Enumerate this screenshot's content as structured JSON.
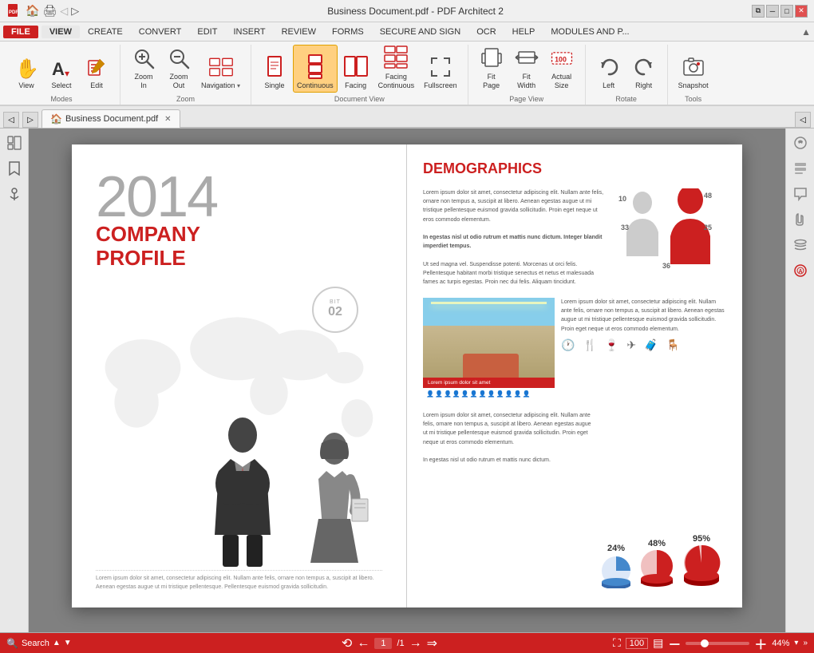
{
  "titleBar": {
    "title": "Business Document.pdf  -  PDF Architect 2",
    "appIcon": "pdf-icon"
  },
  "menuBar": {
    "fileLabel": "FILE",
    "items": [
      "VIEW",
      "CREATE",
      "CONVERT",
      "EDIT",
      "INSERT",
      "REVIEW",
      "FORMS",
      "SECURE AND SIGN",
      "OCR",
      "HELP",
      "MODULES AND P..."
    ]
  },
  "ribbon": {
    "groups": [
      {
        "name": "Modes",
        "buttons": [
          {
            "id": "view",
            "label": "View",
            "icon": "hand"
          },
          {
            "id": "select",
            "label": "Select",
            "icon": "cursor"
          },
          {
            "id": "edit",
            "label": "Edit",
            "icon": "edit"
          }
        ]
      },
      {
        "name": "Zoom",
        "buttons": [
          {
            "id": "zoom-in",
            "label": "Zoom\nIn",
            "icon": "zoom-in"
          },
          {
            "id": "zoom-out",
            "label": "Zoom\nOut",
            "icon": "zoom-out"
          },
          {
            "id": "navigation",
            "label": "Navigation",
            "icon": "nav",
            "hasDropdown": true
          }
        ]
      },
      {
        "name": "Document View",
        "buttons": [
          {
            "id": "single",
            "label": "Single",
            "icon": "single"
          },
          {
            "id": "continuous",
            "label": "Continuous",
            "icon": "continuous",
            "active": true
          },
          {
            "id": "facing",
            "label": "Facing",
            "icon": "facing"
          },
          {
            "id": "facing-continuous",
            "label": "Facing\nContinuous",
            "icon": "facing-cont"
          },
          {
            "id": "fullscreen",
            "label": "Fullscreen",
            "icon": "fullscreen"
          }
        ]
      },
      {
        "name": "Page View",
        "buttons": [
          {
            "id": "fit-page",
            "label": "Fit\nPage",
            "icon": "fit-page"
          },
          {
            "id": "fit-width",
            "label": "Fit\nWidth",
            "icon": "fit-width"
          },
          {
            "id": "actual-size",
            "label": "Actual\nSize",
            "icon": "actual"
          }
        ]
      },
      {
        "name": "Rotate",
        "buttons": [
          {
            "id": "left",
            "label": "Left",
            "icon": "left"
          },
          {
            "id": "right",
            "label": "Right",
            "icon": "right"
          }
        ]
      },
      {
        "name": "Tools",
        "buttons": [
          {
            "id": "snapshot",
            "label": "Snapshot",
            "icon": "snapshot"
          }
        ]
      }
    ]
  },
  "tabs": {
    "tabItems": [
      {
        "id": "main-doc",
        "label": "Business Document.pdf",
        "closable": true
      }
    ]
  },
  "leftSidebar": {
    "buttons": [
      "pages-icon",
      "bookmarks-icon",
      "anchor-icon"
    ]
  },
  "document": {
    "leftPage": {
      "year": "2014",
      "title1": "COMPANY",
      "title2": "PROFILE",
      "badgeTop": "BIT",
      "badgeNum": "02",
      "bottomText": "Lorem ipsum dolor sit amet, consectetur adipiscing elit. Nullam ante felis, ornare non tempus a, suscipit at libero. Aenean egestas augue ut mi tristique pellentesque. Pellentesque euismod gravida sollicitudin."
    },
    "rightPage": {
      "sectionTitle": "DEMOGRAPHICS",
      "bodyText1": "Lorem ipsum dolor sit amet, consectetur adipiscing elit. Nullam ante felis, ornare non tempus a, suscipit at libero. Aenean egestas augue ut mi tristique pellentesque euismod gravida sollicitudin. Proin eget neque ut eros commodo elementum.",
      "boldText1": "In egestas nisl ut odio rutrum et mattis nunc dictum. Integer blandit imperdiet tempus.",
      "bodyText2": "Ut sed magna vel. Suspendisse potenti. Morcenas ut orci felis. Pellentesque habitant morbi tristique senectus et netus et malesuada fames ac turpis egestas. Proin nec dui felis. Aliquam tincidunt.",
      "hotelLabel": "Lorem ipsum dolor sit amet",
      "percentages": [
        {
          "value": "24%",
          "color": "#4488cc"
        },
        {
          "value": "48%",
          "color": "#cc2020"
        },
        {
          "value": "95%",
          "color": "#cc2020"
        }
      ],
      "chartNumbers": [
        "10",
        "48",
        "33",
        "25",
        "36"
      ]
    }
  },
  "rightSidebar": {
    "tools": [
      "settings-icon",
      "find-icon",
      "note-icon",
      "clip-icon",
      "layers-icon",
      "seal-icon"
    ]
  },
  "statusBar": {
    "searchLabel": "Search",
    "searchArrows": [
      "▲",
      "▼"
    ],
    "navButtons": [
      "⟲",
      "←"
    ],
    "pageNum": "1",
    "pageTotal": "/1",
    "navNext": [
      "→",
      "⇒"
    ],
    "zoomOut": "-",
    "zoomIn": "+",
    "zoomPercent": "44%"
  }
}
